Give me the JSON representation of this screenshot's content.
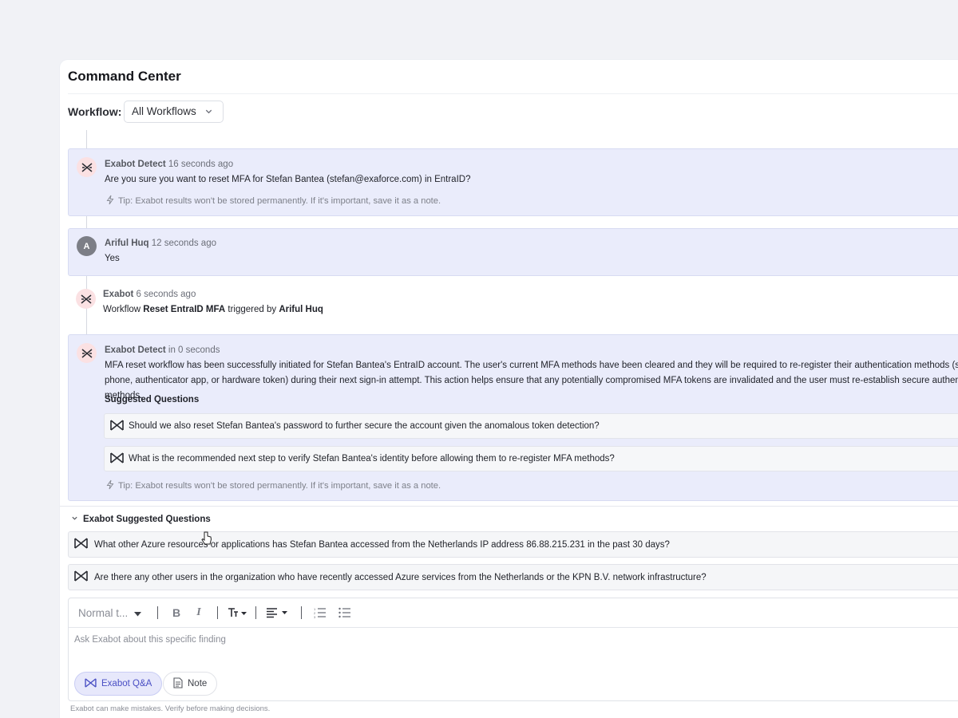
{
  "app": {
    "title": "Command Center",
    "workflow_label": "Workflow:",
    "workflow_value": "All Workflows"
  },
  "colors": {
    "bot_bubble_bg": "#eaecfb",
    "accent": "#4a4fc4",
    "bot_avatar_bg": "#fbe1e3"
  },
  "messages": [
    {
      "author": "Exabot Detect",
      "time": "16 seconds ago",
      "text": "Are you sure you want to reset MFA for Stefan Bantea (stefan@exaforce.com) in EntraID?",
      "tip": "Tip: Exabot results won't be stored permanently. If it's important, save it as a note.",
      "avatar_icon": "exabot-icon"
    },
    {
      "author": "Ariful Huq",
      "time": "12 seconds ago",
      "text": "Yes",
      "avatar_letter": "A"
    },
    {
      "author": "Exabot",
      "time": "6 seconds ago",
      "text_prefix": "Workflow",
      "workflow_name": "Reset EntraID MFA",
      "text_mid": "triggered by",
      "trigger_user": "Ariful Huq",
      "avatar_icon": "exabot-icon"
    },
    {
      "author": "Exabot Detect",
      "time": "in 0 seconds",
      "text": "MFA reset workflow has been successfully initiated for Stefan Bantea's EntraID account. The user's current MFA methods have been cleared and they will be required to re-register their authentication methods (such as phone, authenticator app, or hardware token) during their next sign-in attempt. This action helps ensure that any potentially compromised MFA tokens are invalidated and the user must re-establish secure authentication methods.",
      "suggested_title": "Suggested Questions",
      "suggested": [
        "Should we also reset Stefan Bantea's password to further secure the account given the anomalous token detection?",
        "What is the recommended next step to verify Stefan Bantea's identity before allowing them to re-register MFA methods?"
      ],
      "tip": "Tip: Exabot results won't be stored permanently. If it's important, save it as a note.",
      "avatar_icon": "exabot-icon"
    }
  ],
  "exabot_suggested": {
    "title": "Exabot Suggested Questions",
    "items": [
      "What other Azure resources or applications has Stefan Bantea accessed from the Netherlands IP address 86.88.215.231 in the past 30 days?",
      "Are there any other users in the organization who have recently accessed Azure services from the Netherlands or the KPN B.V. network infrastructure?"
    ]
  },
  "editor": {
    "text_style": "Normal t...",
    "toolbar_icons": [
      "bold-icon",
      "italic-icon",
      "text-size-icon",
      "align-icon",
      "ordered-list-icon",
      "bullet-list-icon"
    ],
    "bold_label": "B",
    "italic_label": "I",
    "placeholder": "Ask Exabot about this specific finding",
    "mode_qa": "Exabot Q&A",
    "mode_note": "Note"
  },
  "disclaimer": "Exabot can make mistakes. Verify before making decisions."
}
